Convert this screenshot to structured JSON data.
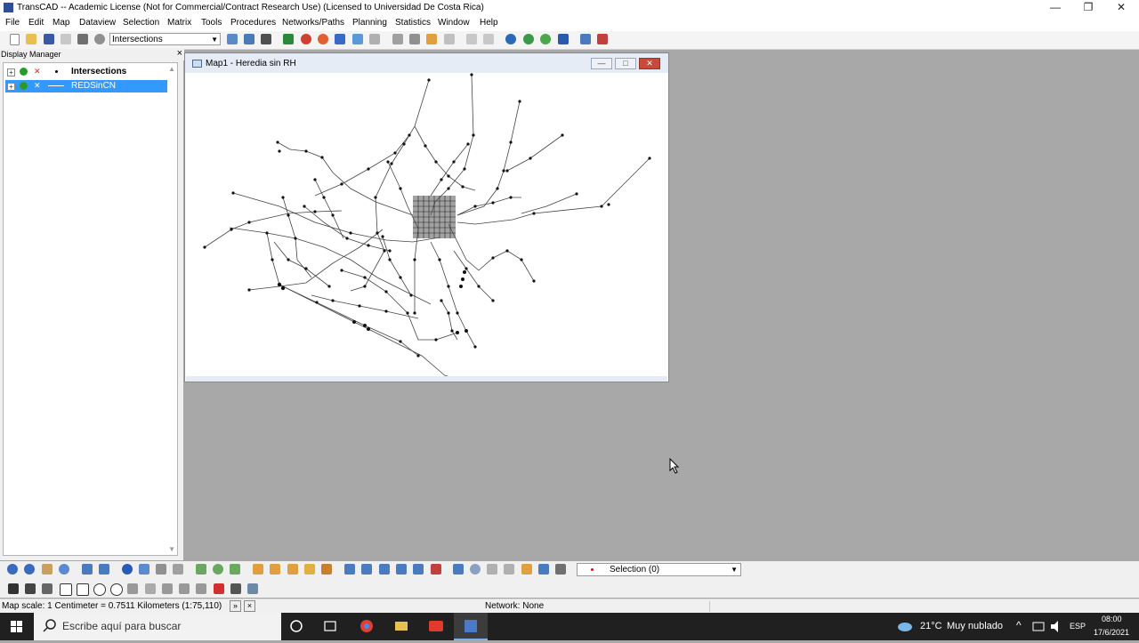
{
  "window": {
    "title": "TransCAD -- Academic License (Not for Commercial/Contract Research Use) (Licensed to Universidad De Costa Rica)",
    "minimize": "—",
    "restore": "❐",
    "close": "✕"
  },
  "menu": [
    "File",
    "Edit",
    "Map",
    "Dataview",
    "Selection",
    "Matrix",
    "Tools",
    "Procedures",
    "Networks/Paths",
    "Planning",
    "Statistics",
    "Window",
    "Help"
  ],
  "toolbar": {
    "layer_select": "Intersections"
  },
  "display_manager": {
    "title": "Display Manager",
    "close": "×",
    "layers": [
      {
        "name": "Intersections",
        "selected": false
      },
      {
        "name": "REDSinCN",
        "selected": true
      }
    ]
  },
  "map_window": {
    "title": "Map1 - Heredia sin RH",
    "minimize": "—",
    "maximize": "□",
    "close": "✕"
  },
  "selection": {
    "label": "Selection (0)"
  },
  "status": {
    "scale": "Map scale: 1 Centimeter = 0.7511 Kilometers (1:75,110)",
    "network": "Network: None"
  },
  "taskbar": {
    "search_placeholder": "Escribe aquí para buscar",
    "weather_temp": "21°C",
    "weather_desc": "Muy nublado",
    "language": "ESP",
    "time": "08:00",
    "date": "17/6/2021"
  },
  "colors": {
    "selection_highlight": "#3399ff",
    "workspace": "#a8a8a8",
    "taskbar": "#202020"
  }
}
